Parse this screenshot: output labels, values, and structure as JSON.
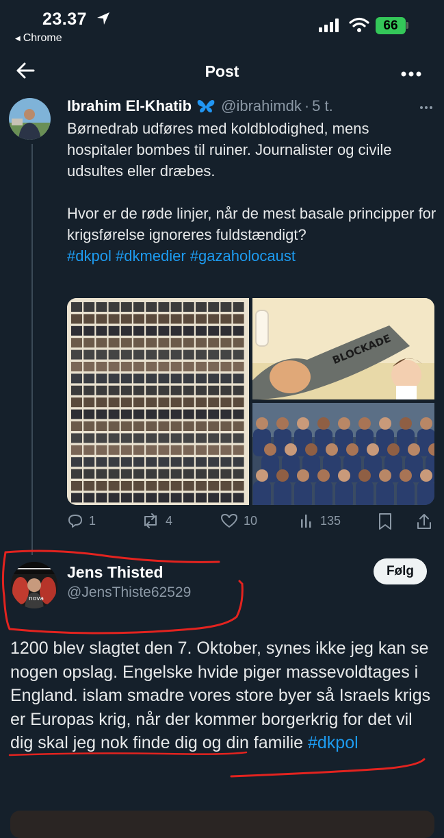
{
  "status_bar": {
    "time": "23.37",
    "back_app": "Chrome",
    "battery": "66"
  },
  "header": {
    "title": "Post"
  },
  "tweet": {
    "author_name": "Ibrahim El-Khatib",
    "handle": "@ibrahimdk",
    "separator": "·",
    "time": "5 t.",
    "paragraphs": [
      "Børnedrab udføres med koldblodighed, mens hospitaler bombes til ruiner. Journalister og civile udsultes eller dræbes.",
      "Hvor er de røde linjer, når de mest basale principper for krigsførelse ignoreres fuldstændigt?"
    ],
    "hashtags": [
      "#dkpol",
      "#dkmedier",
      "#gazaholocaust"
    ],
    "media": {
      "image_2_caption": "BLOCKADE"
    },
    "stats": {
      "replies": "1",
      "reposts": "4",
      "likes": "10",
      "views": "135"
    }
  },
  "reply": {
    "author_name": "Jens Thisted",
    "handle": "@JensThiste62529",
    "follow_label": "Følg",
    "avatar_text": "nova",
    "text": "1200 blev slagtet den 7. Oktober, synes ikke jeg kan se nogen opslag. Engelske hvide piger massevoldtages i England. islam smadre vores store byer så Israels krigs er Europas krig, når der kommer borgerkrig for det vil dig skal jeg nok finde dig og din familie",
    "hashtag": "#dkpol"
  },
  "colors": {
    "background": "#15202b",
    "accent": "#1d9bf0",
    "annotation_red": "#e3231f"
  }
}
